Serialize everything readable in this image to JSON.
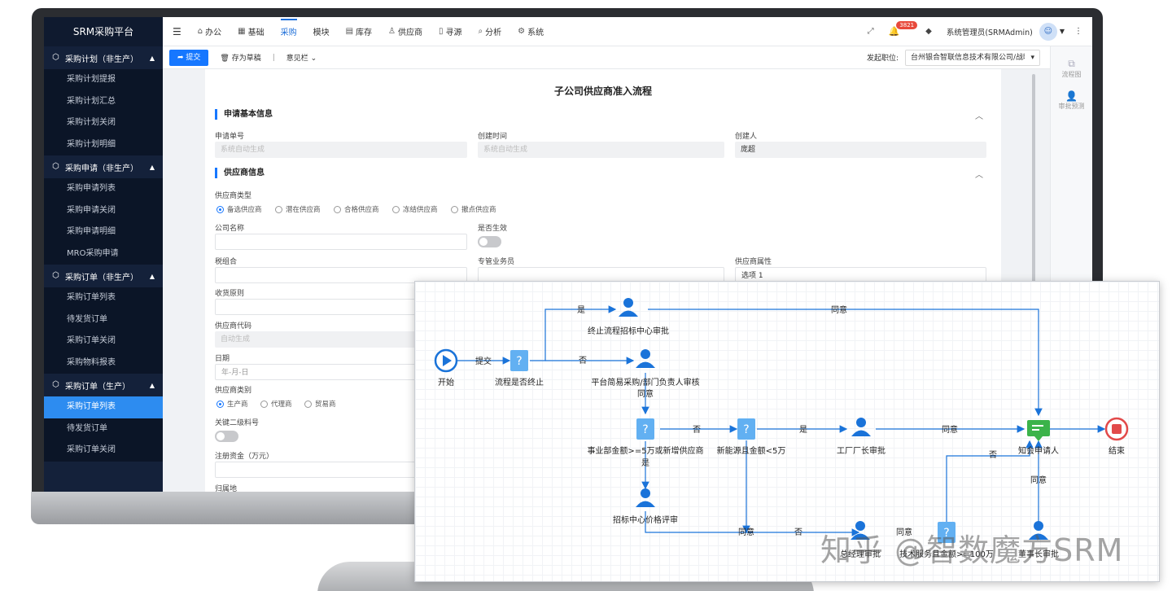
{
  "sidebar": {
    "brand": "SRM采购平台",
    "groups": [
      {
        "title": "采购计划（非生产）",
        "items": [
          "采购计划提报",
          "采购计划汇总",
          "采购计划关闭",
          "采购计划明细"
        ]
      },
      {
        "title": "采购申请（非生产）",
        "items": [
          "采购申请列表",
          "采购申请关闭",
          "采购申请明细",
          "MRO采购申请"
        ]
      },
      {
        "title": "采购订单（非生产）",
        "items": [
          "采购订单列表",
          "待发货订单",
          "采购订单关闭",
          "采购物料报表"
        ]
      },
      {
        "title": "采购订单（生产）",
        "items": [
          "采购订单列表",
          "待发货订单",
          "采购订单关闭"
        ]
      }
    ],
    "active_item": "采购订单列表"
  },
  "topbar": {
    "tabs": [
      {
        "label": "办公",
        "icon": "home-icon"
      },
      {
        "label": "基础",
        "icon": "grid-icon"
      },
      {
        "label": "采购",
        "icon": ""
      },
      {
        "label": "模块",
        "icon": ""
      },
      {
        "label": "库存",
        "icon": "box-icon"
      },
      {
        "label": "供应商",
        "icon": "user-icon"
      },
      {
        "label": "寻源",
        "icon": "doc-icon"
      },
      {
        "label": "分析",
        "icon": "search-icon"
      },
      {
        "label": "系统",
        "icon": "gear-icon"
      }
    ],
    "active_tab": "采购",
    "notification_count": "3821",
    "user": "系统管理员(SRMAdmin)"
  },
  "actionbar": {
    "submit": "提交",
    "save_draft": "存为草稿",
    "opinion": "意见栏",
    "post_label": "发起职位:",
    "post_value": "台州银合智联信息技术有限公司/战略"
  },
  "rail": {
    "flow_chart": "流程图",
    "approval_preview": "审批预测"
  },
  "form": {
    "title": "子公司供应商准入流程",
    "section_basic": "申请基本信息",
    "section_supplier": "供应商信息",
    "fields": {
      "apply_no_label": "申请单号",
      "apply_no_value": "系统自动生成",
      "create_time_label": "创建时间",
      "create_time_value": "系统自动生成",
      "creator_label": "创建人",
      "creator_value": "庞超",
      "supplier_type_label": "供应商类型",
      "supplier_types": [
        "备选供应商",
        "潜在供应商",
        "合格供应商",
        "冻结供应商",
        "撤点供应商"
      ],
      "company_name_label": "公司名称",
      "effective_label": "是否生效",
      "tax_combo_label": "税组合",
      "staff_label": "专管业务员",
      "attr_label": "供应商属性",
      "attr_value": "选项 1",
      "receive_label": "收货原则",
      "code_label": "供应商代码",
      "code_value": "自动生成",
      "date_label": "日期",
      "date_placeholder": "年-月-日",
      "category_label": "供应商类别",
      "categories": [
        "生产商",
        "代理商",
        "贸易商"
      ],
      "key_material_label": "关键二级料号",
      "capital_label": "注册资金（万元）",
      "region_label": "归属地"
    }
  },
  "flow": {
    "labels": {
      "start": "开始",
      "check_end": "流程是否终止",
      "terminate_review": "终止流程招标中心审批",
      "dept_review": "平台简易采购/部门负责人审核",
      "amount_check": "事业部金额>=5万或新增供应商",
      "new_energy_check": "新能源且金额<5万",
      "factory_review": "工厂厂长审批",
      "notify": "知会申请人",
      "end": "结束",
      "price_review": "招标中心价格评审",
      "manager_review": "总经理审批",
      "tech_check": "技术服务且金额>=100万",
      "chairman_review": "董事长审批"
    },
    "edges": {
      "submit": "提交",
      "yes": "是",
      "no": "否",
      "agree": "同意"
    }
  },
  "watermark": "知乎 @智数魔方SRM"
}
